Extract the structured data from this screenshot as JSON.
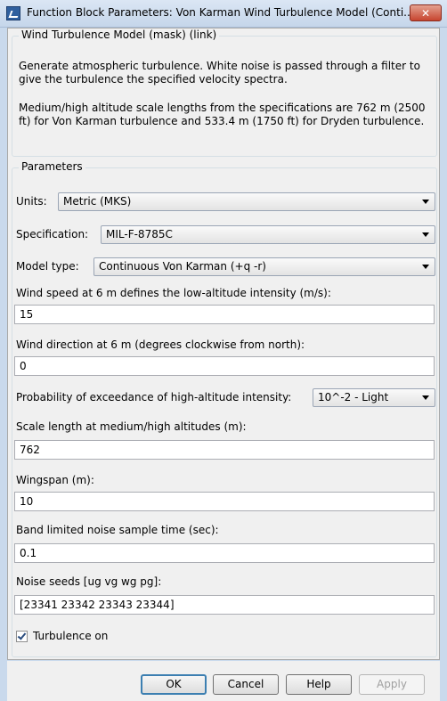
{
  "window": {
    "title": "Function Block Parameters: Von Karman Wind Turbulence Model (Conti...",
    "close_glyph": "✕"
  },
  "mask": {
    "legend": "Wind Turbulence Model (mask) (link)",
    "description_1": "Generate atmospheric turbulence. White noise is passed through a filter to give the turbulence the specified velocity spectra.",
    "description_2": "Medium/high altitude scale lengths from the specifications are 762 m (2500 ft) for Von Karman turbulence and 533.4 m (1750 ft) for Dryden turbulence."
  },
  "params": {
    "legend": "Parameters",
    "units_label": "Units:",
    "units_value": "Metric (MKS)",
    "spec_label": "Specification:",
    "spec_value": "MIL-F-8785C",
    "model_label": "Model type:",
    "model_value": "Continuous Von Karman (+q -r)",
    "wind_speed_label": "Wind speed at 6 m defines the low-altitude intensity (m/s):",
    "wind_speed_value": "15",
    "wind_dir_label": "Wind direction at 6 m (degrees clockwise from north):",
    "wind_dir_value": "0",
    "prob_label": "Probability of exceedance of high-altitude intensity:",
    "prob_value": "10^-2 - Light",
    "scale_label": "Scale length at medium/high altitudes (m):",
    "scale_value": "762",
    "wingspan_label": "Wingspan (m):",
    "wingspan_value": "10",
    "band_label": "Band limited noise sample time (sec):",
    "band_value": "0.1",
    "seeds_label": "Noise seeds [ug vg wg pg]:",
    "seeds_value": "[23341 23342 23343 23344]",
    "turbulence_label": "Turbulence on",
    "turbulence_checked": true
  },
  "buttons": {
    "ok": "OK",
    "cancel": "Cancel",
    "help": "Help",
    "apply": "Apply"
  }
}
